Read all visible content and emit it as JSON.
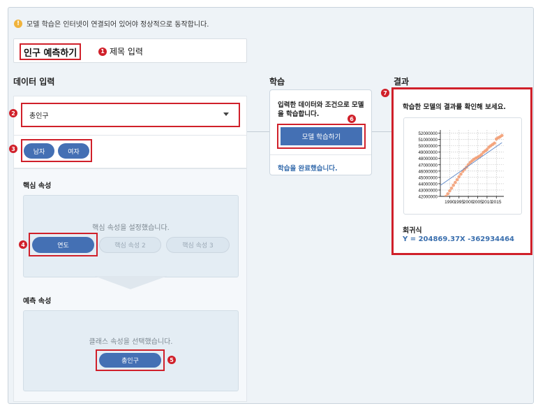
{
  "notice": "모델 학습은 인터넷이 연결되어 있어야 정상적으로 동작합니다.",
  "title": {
    "value": "인구 예측하기",
    "badge": "1",
    "label": "제목 입력"
  },
  "data_section": {
    "heading": "데이터 입력",
    "dropdown": {
      "badge": "2",
      "selected": "총인구"
    },
    "gender": {
      "badge": "3",
      "options": [
        "남자",
        "여자"
      ]
    },
    "core_attr": {
      "heading": "핵심 속성",
      "message": "핵심 속성을 설정했습니다.",
      "badge": "4",
      "chips": [
        "연도",
        "핵심 속성 2",
        "핵심 속성 3"
      ]
    },
    "predict_attr": {
      "heading": "예측 속성",
      "message": "클래스 속성을 선택했습니다.",
      "badge": "5",
      "chip": "총인구"
    }
  },
  "learn_section": {
    "heading": "학습",
    "description": "입력한 데이터와 조건으로 모델을 학습합니다.",
    "badge": "6",
    "button": "모델 학습하기",
    "status": "학습을 완료했습니다."
  },
  "result_section": {
    "heading": "결과",
    "badge": "7",
    "description": "학습한 모델의 결과를 확인해 보세요.",
    "regression_heading": "회귀식",
    "regression_equation": "Y = 204869.37X -362934464"
  },
  "colors": {
    "accent": "#4470b4",
    "annotation": "#d0202a",
    "data": "#f29a6f",
    "fit": "#5b86c8"
  },
  "chart_data": {
    "type": "scatter",
    "x_ticks": [
      "1990",
      "1995",
      "2000",
      "2005",
      "2010",
      "2015"
    ],
    "y_ticks": [
      "42000000",
      "43000000",
      "44000000",
      "45000000",
      "46000000",
      "47000000",
      "48000000",
      "49000000",
      "50000000",
      "51000000",
      "52000000"
    ],
    "xlim": [
      1985,
      2019
    ],
    "ylim": [
      42000000,
      52500000
    ],
    "series": [
      {
        "x": [
          1985,
          1986,
          1987,
          1988,
          1989,
          1990,
          1991,
          1992,
          1993,
          1994,
          1995,
          1996,
          1997,
          1998,
          1999,
          2000,
          2001,
          2002,
          2003,
          2004,
          2005,
          2006,
          2007,
          2008,
          2009,
          2010,
          2011,
          2012,
          2013,
          2014,
          2015,
          2016,
          2017,
          2018
        ],
        "values": [
          40800000,
          41200000,
          41600000,
          42000000,
          42400000,
          42870000,
          43300000,
          43750000,
          44200000,
          44640000,
          45090000,
          45520000,
          45950000,
          46290000,
          46620000,
          47010000,
          47360000,
          47620000,
          47860000,
          48040000,
          48180000,
          48370000,
          48600000,
          48950000,
          49180000,
          49410000,
          49780000,
          50000000,
          50220000,
          50420000,
          51070000,
          51270000,
          51420000,
          51630000
        ]
      }
    ],
    "fit_line": {
      "x": [
        1985,
        2018
      ],
      "values": [
        43736740,
        50497429
      ]
    }
  }
}
